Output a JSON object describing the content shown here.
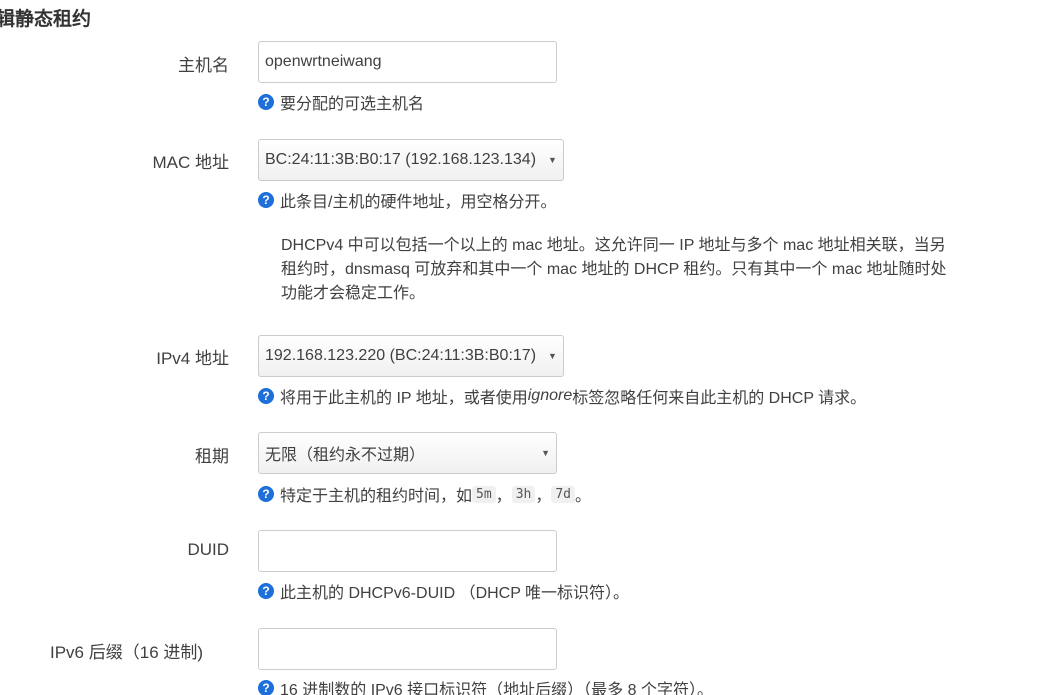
{
  "page_title": "辑静态租约",
  "hostname": {
    "label": "主机名",
    "value": "openwrtneiwang",
    "help": "要分配的可选主机名"
  },
  "mac": {
    "label": "MAC 地址",
    "selected": "BC:24:11:3B:B0:17 (192.168.123.134)",
    "help": "此条目/主机的硬件地址，用空格分开。",
    "para_lines": [
      "DHCPv4 中可以包括一个以上的 mac 地址。这允许同一 IP 地址与多个 mac 地址相关联，当另",
      "租约时，dnsmasq 可放弃和其中一个 mac 地址的 DHCP 租约。只有其中一个 mac 地址随时处",
      "功能才会稳定工作。"
    ]
  },
  "ipv4": {
    "label": "IPv4 地址",
    "selected": "192.168.123.220 (BC:24:11:3B:B0:17)",
    "help_before": "将用于此主机的 IP 地址，或者使用",
    "help_em": "ignore",
    "help_after": "标签忽略任何来自此主机的 DHCP 请求。"
  },
  "lease": {
    "label": "租期",
    "selected": "无限（租约永不过期）",
    "help_before": "特定于主机的租约时间，如 ",
    "codes": [
      "5m",
      "3h",
      "7d"
    ],
    "sep": "，",
    "end": "。"
  },
  "duid": {
    "label": "DUID",
    "value": "",
    "help": "此主机的 DHCPv6-DUID （DHCP 唯一标识符）。"
  },
  "ipv6suffix": {
    "label": "IPv6 后缀（16 进制)",
    "value": "",
    "help": "16 进制数的 IPv6 接口标识符（地址后缀）（最多 8 个字符）。"
  },
  "icons": {
    "help": "question-circle-icon",
    "dropdown": "caret-down-icon",
    "help_glyph": "?",
    "caret_glyph": "▼"
  },
  "colors": {
    "help_icon": "#1e6fd9",
    "input_border": "#cccccc",
    "text": "#404040"
  }
}
